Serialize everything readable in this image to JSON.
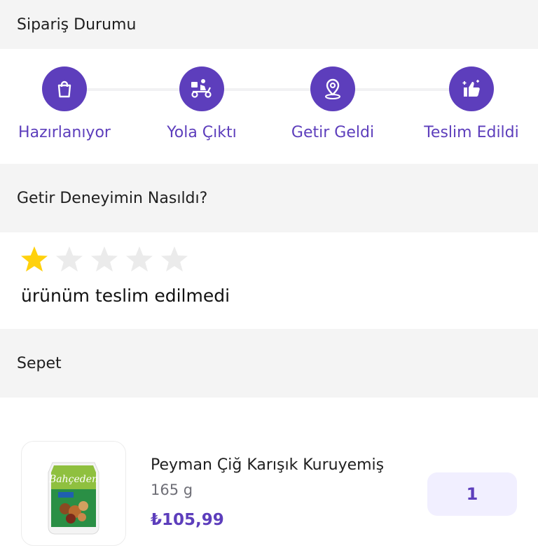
{
  "order_status": {
    "title": "Sipariş Durumu",
    "steps": [
      {
        "label": "Hazırlanıyor",
        "icon": "shopping-bag-icon"
      },
      {
        "label": "Yola Çıktı",
        "icon": "courier-scooter-icon"
      },
      {
        "label": "Getir Geldi",
        "icon": "location-pin-icon"
      },
      {
        "label": "Teslim Edildi",
        "icon": "thumbs-up-icon"
      }
    ]
  },
  "rating": {
    "title": "Getir Deneyimin Nasıldı?",
    "stars_filled": 1,
    "stars_total": 5,
    "comment": "ürünüm teslim edilmedi"
  },
  "basket": {
    "title": "Sepet",
    "items": [
      {
        "name": "Peyman Çiğ Karışık Kuruyemiş",
        "weight": "165 g",
        "price": "₺105,99",
        "quantity": "1",
        "image_brand_text": "Bahçeden"
      }
    ]
  },
  "colors": {
    "accent": "#5d3ebc",
    "star_filled": "#ffd10d",
    "star_empty": "#ebebeb",
    "section_bg": "#f4f4f4",
    "qty_bg": "#f1efff"
  }
}
